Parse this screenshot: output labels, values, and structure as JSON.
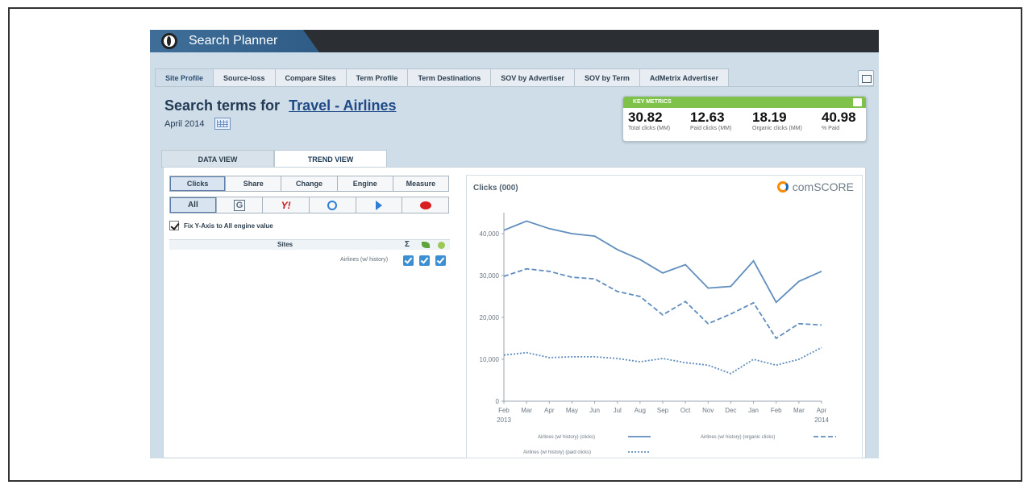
{
  "app": {
    "title": "Search Planner"
  },
  "tabs": [
    "Site Profile",
    "Source-loss",
    "Compare Sites",
    "Term Profile",
    "Term Destinations",
    "SOV by Advertiser",
    "SOV by Term",
    "AdMetrix Advertiser"
  ],
  "active_tab_index": 0,
  "page": {
    "heading_prefix": "Search terms for",
    "topic": "Travel - Airlines",
    "date": "April 2014"
  },
  "key_metrics": {
    "header": "KEY METRICS",
    "items": [
      {
        "value": "30.82",
        "label": "Total clicks (MM)"
      },
      {
        "value": "12.63",
        "label": "Paid clicks (MM)"
      },
      {
        "value": "18.19",
        "label": "Organic clicks (MM)"
      },
      {
        "value": "40.98",
        "label": "% Paid"
      }
    ]
  },
  "view_tabs": [
    {
      "label": "DATA VIEW",
      "active": false
    },
    {
      "label": "TREND VIEW",
      "active": true
    }
  ],
  "metric_buttons": [
    {
      "label": "Clicks",
      "active": true
    },
    {
      "label": "Share",
      "active": false
    },
    {
      "label": "Change",
      "active": false
    },
    {
      "label": "Engine",
      "active": false
    },
    {
      "label": "Measure",
      "active": false
    }
  ],
  "engine_buttons": [
    {
      "label": "All",
      "icon": "all",
      "active": true
    },
    {
      "label": "G",
      "icon": "google-icon",
      "active": false
    },
    {
      "label": "Y!",
      "icon": "yahoo-icon",
      "active": false
    },
    {
      "label": "",
      "icon": "bing-icon",
      "active": false
    },
    {
      "label": "",
      "icon": "ask-icon",
      "active": false
    },
    {
      "label": "",
      "icon": "aol-icon",
      "active": false
    }
  ],
  "fix_axis_label": "Fix Y-Axis to All engine value",
  "sites": {
    "header": "Sites",
    "sigma": "Σ",
    "rows": [
      {
        "name": "Airlines (w/ history)"
      }
    ]
  },
  "chart": {
    "title": "Clicks (000)",
    "logo_text": "comSCORE"
  },
  "chart_data": {
    "type": "line",
    "title": "Clicks (000)",
    "x": [
      "Feb 2013",
      "Mar",
      "Apr",
      "May",
      "Jun",
      "Jul",
      "Aug",
      "Sep",
      "Oct",
      "Nov",
      "Dec",
      "Jan",
      "Feb",
      "Mar",
      "Apr 2014"
    ],
    "x_tick_lines": [
      [
        "Feb",
        "2013"
      ],
      [
        "Mar"
      ],
      [
        "Apr"
      ],
      [
        "May"
      ],
      [
        "Jun"
      ],
      [
        "Jul"
      ],
      [
        "Aug"
      ],
      [
        "Sep"
      ],
      [
        "Oct"
      ],
      [
        "Nov"
      ],
      [
        "Dec"
      ],
      [
        "Jan"
      ],
      [
        "Feb"
      ],
      [
        "Mar"
      ],
      [
        "Apr",
        "2014"
      ]
    ],
    "ylim": [
      0,
      45000
    ],
    "y_ticks": [
      "0",
      "10,000",
      "20,000",
      "30,000",
      "40,000"
    ],
    "series": [
      {
        "name": "Airlines (w/ history) (clicks)",
        "style": "solid",
        "values": [
          40800,
          43000,
          41200,
          40000,
          39400,
          36200,
          33800,
          30600,
          32600,
          27000,
          27400,
          33500,
          23600,
          28600,
          31000
        ]
      },
      {
        "name": "Airlines (w/ history) (organic clicks)",
        "style": "dashed",
        "values": [
          29800,
          31600,
          31000,
          29600,
          29200,
          26200,
          25000,
          20600,
          23800,
          18500,
          20800,
          23500,
          15000,
          18500,
          18200
        ]
      },
      {
        "name": "Airlines (w/ history) (paid clicks)",
        "style": "dotted",
        "values": [
          11000,
          11600,
          10400,
          10600,
          10600,
          10200,
          9400,
          10200,
          9200,
          8600,
          6600,
          10000,
          8600,
          10000,
          12800
        ]
      }
    ],
    "colors": {
      "line": "#5f8dbd"
    }
  }
}
